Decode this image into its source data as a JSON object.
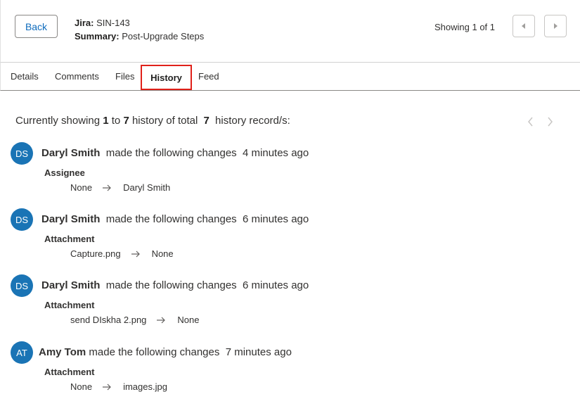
{
  "header": {
    "back_label": "Back",
    "jira_label": "Jira:",
    "jira_value": "SIN-143",
    "summary_label": "Summary:",
    "summary_value": "Post-Upgrade Steps",
    "showing_text": "Showing 1 of 1"
  },
  "tabs": [
    {
      "label": "Details"
    },
    {
      "label": "Comments"
    },
    {
      "label": "Files"
    },
    {
      "label": "History",
      "active": true
    },
    {
      "label": "Feed"
    }
  ],
  "history": {
    "summary_prefix": "Currently showing",
    "from": "1",
    "to_word": "to",
    "to": "7",
    "mid_text": "history of total",
    "total": "7",
    "suffix": "history record/s:",
    "records": [
      {
        "initials": "DS",
        "author": "Daryl Smith",
        "action": "made the following changes",
        "time": "4 minutes ago",
        "field": "Assignee",
        "from": "None",
        "to": "Daryl Smith"
      },
      {
        "initials": "DS",
        "author": "Daryl Smith",
        "action": "made the following changes",
        "time": "6 minutes ago",
        "field": "Attachment",
        "from": "Capture.png",
        "to": "None"
      },
      {
        "initials": "DS",
        "author": "Daryl Smith",
        "action": "made the following changes",
        "time": "6 minutes ago",
        "field": "Attachment",
        "from": "send DIskha 2.png",
        "to": "None"
      },
      {
        "initials": "AT",
        "author": "Amy Tom",
        "action": "made the following changes",
        "time": "7 minutes ago",
        "field": "Attachment",
        "from": "None",
        "to": "images.jpg"
      }
    ]
  },
  "colors": {
    "avatar": "#1a74b5",
    "accent": "#0f6cbd",
    "active_tab_border": "#e0211a"
  }
}
